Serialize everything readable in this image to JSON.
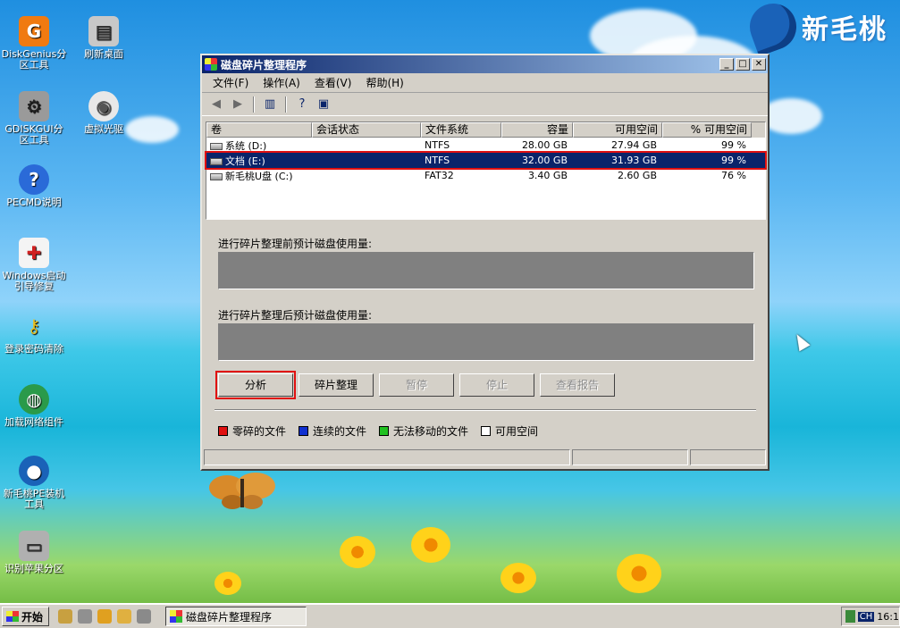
{
  "desktop": {
    "brand_text": "新毛桃",
    "icons": [
      {
        "label": "DiskGenius分区工具",
        "name": "diskgenius"
      },
      {
        "label": "刷新桌面",
        "name": "refresh-desktop"
      },
      {
        "label": "GDISKGUI分区工具",
        "name": "gdiskgui"
      },
      {
        "label": "虚拟光驱",
        "name": "virtual-drive"
      },
      {
        "label": "PECMD说明",
        "name": "pecmd-help"
      },
      {
        "label": "Windows启动引导修复",
        "name": "boot-repair"
      },
      {
        "label": "登录密码清除",
        "name": "password-clear"
      },
      {
        "label": "加载网络组件",
        "name": "load-network"
      },
      {
        "label": "新毛桃PE装机工具",
        "name": "pe-installer"
      },
      {
        "label": "识别苹果分区",
        "name": "apple-partition"
      }
    ]
  },
  "window": {
    "title": "磁盘碎片整理程序",
    "menu": [
      "文件(F)",
      "操作(A)",
      "查看(V)",
      "帮助(H)"
    ],
    "list": {
      "columns": [
        "卷",
        "会话状态",
        "文件系统",
        "容量",
        "可用空间",
        "% 可用空间"
      ],
      "rows": [
        {
          "volume": "系统 (D:)",
          "status": "",
          "fs": "NTFS",
          "capacity": "28.00 GB",
          "free": "27.94 GB",
          "pct": "99 %"
        },
        {
          "volume": "文档 (E:)",
          "status": "",
          "fs": "NTFS",
          "capacity": "32.00 GB",
          "free": "31.93 GB",
          "pct": "99 %"
        },
        {
          "volume": "新毛桃U盘  (C:)",
          "status": "",
          "fs": "FAT32",
          "capacity": "3.40 GB",
          "free": "2.60 GB",
          "pct": "76 %"
        }
      ]
    },
    "before_label": "进行碎片整理前预计磁盘使用量:",
    "after_label": "进行碎片整理后预计磁盘使用量:",
    "buttons": {
      "analyze": "分析",
      "defrag": "碎片整理",
      "pause": "暂停",
      "stop": "停止",
      "report": "查看报告"
    },
    "legend": [
      {
        "label": "零碎的文件",
        "color": "#e01010"
      },
      {
        "label": "连续的文件",
        "color": "#1030d0"
      },
      {
        "label": "无法移动的文件",
        "color": "#20c020"
      },
      {
        "label": "可用空间",
        "color": "#ffffff"
      }
    ]
  },
  "taskbar": {
    "start_label": "开始",
    "task_label": "磁盘碎片整理程序",
    "lang": "CH",
    "clock": "16:1"
  }
}
